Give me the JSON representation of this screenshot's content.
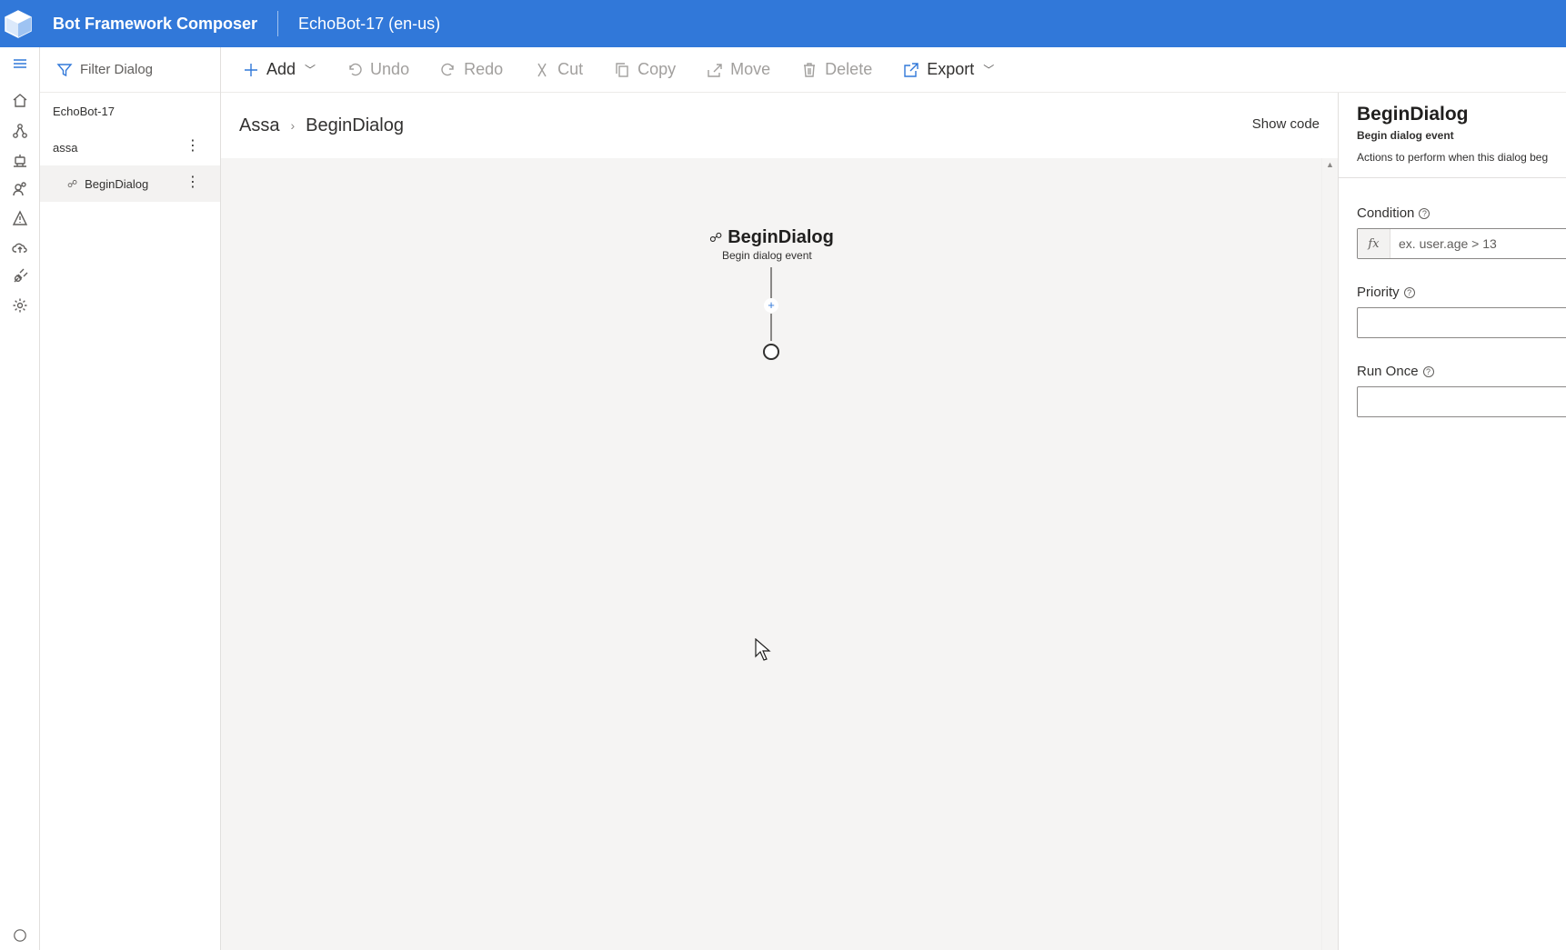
{
  "header": {
    "app_title": "Bot Framework Composer",
    "project_title": "EchoBot-17 (en-us)",
    "background_color": "#3178d9"
  },
  "rail": {
    "items": [
      "hamburger-icon",
      "home-icon",
      "design-icon",
      "bot-responses-icon",
      "knowledge-icon",
      "notifications-icon",
      "publish-icon",
      "extensions-icon",
      "settings-icon"
    ]
  },
  "tree": {
    "filter_label": "Filter Dialog",
    "project_name": "EchoBot-17",
    "dialog_name": "assa",
    "trigger_name": "BeginDialog"
  },
  "toolbar": {
    "add": "Add",
    "undo": "Undo",
    "redo": "Redo",
    "cut": "Cut",
    "copy": "Copy",
    "move": "Move",
    "delete": "Delete",
    "export": "Export"
  },
  "breadcrumb": {
    "dialog": "Assa",
    "trigger": "BeginDialog",
    "show_code": "Show code"
  },
  "canvas": {
    "node_title": "BeginDialog",
    "node_subtitle": "Begin dialog event",
    "add_symbol": "+"
  },
  "properties": {
    "title": "BeginDialog",
    "subtitle": "Begin dialog event",
    "description": "Actions to perform when this dialog beg",
    "condition_label": "Condition",
    "condition_prefix": "fx",
    "condition_placeholder": "ex. user.age > 13",
    "priority_label": "Priority",
    "priority_value": "",
    "run_once_label": "Run Once",
    "run_once_value": ""
  }
}
